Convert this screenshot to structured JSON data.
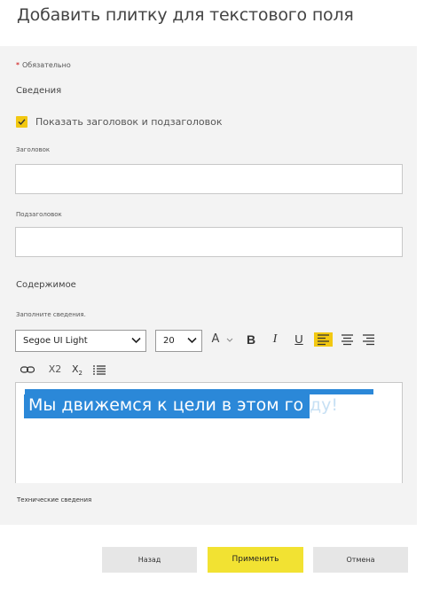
{
  "dialog": {
    "title": "Добавить плитку для текстового поля"
  },
  "form": {
    "required_note": "Обязательно",
    "details_header": "Сведения",
    "show_title_checkbox": {
      "label": "Показать заголовок и подзаголовок",
      "checked": true
    },
    "title_field": {
      "label": "Заголовок",
      "value": ""
    },
    "subtitle_field": {
      "label": "Подзаголовок",
      "value": ""
    },
    "content_header": "Содержимое",
    "content_hint": "Заполните сведения.",
    "toolbar": {
      "font_family": "Segoe UI Light",
      "font_size": "20",
      "font_color_glyph": "A",
      "bold": "B",
      "italic": "I",
      "underline": "U",
      "superscript": "X2",
      "subscript_base": "X",
      "subscript_sub": "2",
      "active_align": "align-left",
      "accent": "#f2c811"
    },
    "editor": {
      "text_selected": "Мы движемся к цели в этом го",
      "text_tail": "ду!",
      "selection_color": "#2b88d8"
    },
    "tech_link": "Технические сведения"
  },
  "buttons": {
    "back": "Назад",
    "apply": "Применить",
    "cancel": "Отмена"
  }
}
